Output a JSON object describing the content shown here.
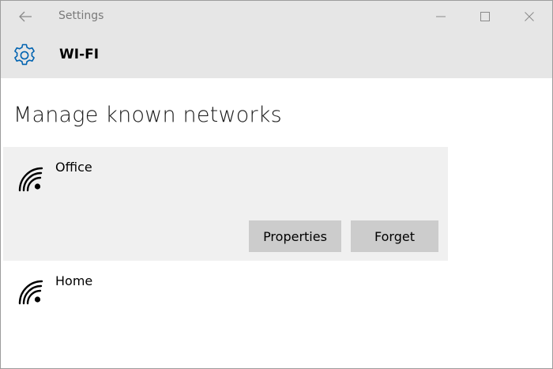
{
  "window": {
    "title": "Settings",
    "controls": {
      "minimize": "minimize-icon",
      "maximize": "maximize-icon",
      "close": "close-icon"
    }
  },
  "header": {
    "icon": "gear-icon",
    "section": "WI-FI"
  },
  "page": {
    "title": "Manage known networks"
  },
  "networks": [
    {
      "name": "Office",
      "icon": "wifi-icon",
      "selected": true,
      "actions": {
        "properties": "Properties",
        "forget": "Forget"
      }
    },
    {
      "name": "Home",
      "icon": "wifi-icon",
      "selected": false
    }
  ],
  "colors": {
    "titlebar_bg": "#e6e6e6",
    "selected_bg": "#f0f0f0",
    "button_bg": "#cccccc",
    "accent_icon": "#0063b1"
  }
}
